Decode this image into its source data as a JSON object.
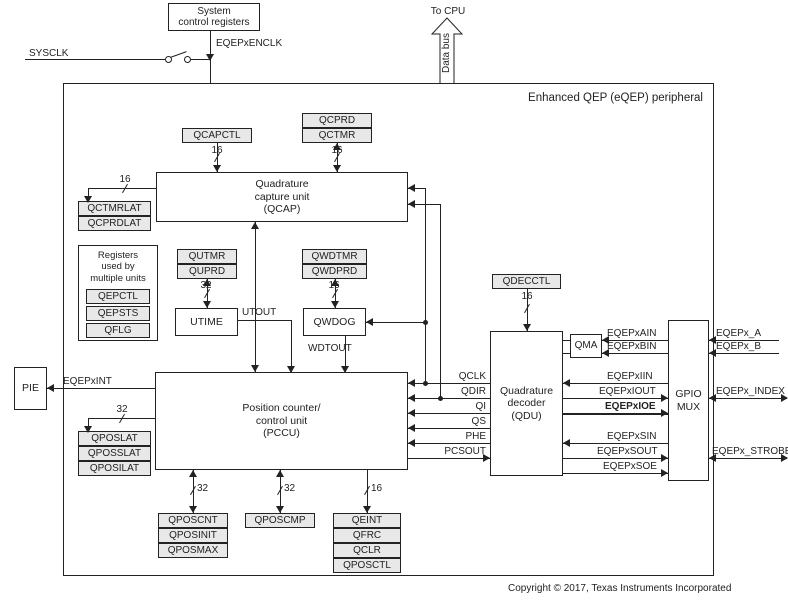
{
  "title": "Enhanced QEP (eQEP) peripheral",
  "top": {
    "sys_ctrl": "System\ncontrol registers",
    "enclk": "EQEPxENCLK",
    "sysclk": "SYSCLK",
    "to_cpu": "To CPU",
    "data_bus": "Data bus"
  },
  "left": {
    "pie": "PIE",
    "eqepxint": "EQEPxINT"
  },
  "qcap": {
    "title": "Quadrature\ncapture unit\n(QCAP)",
    "qcapctl": "QCAPCTL",
    "qcprd": "QCPRD",
    "qctmr": "QCTMR",
    "w_qcapctl": "16",
    "w_qctmr": "16",
    "qctmrlat": "QCTMRLAT",
    "qcprdlat": "QCPRDLAT",
    "w_lat": "16"
  },
  "utime": {
    "title": "UTIME",
    "qutmr": "QUTMR",
    "quprd": "QUPRD",
    "w": "32",
    "utout": "UTOUT"
  },
  "qwdog": {
    "title": "QWDOG",
    "qwdtmr": "QWDTMR",
    "qwdprd": "QWDPRD",
    "w": "16",
    "wdtout": "WDTOUT"
  },
  "shared_regs": {
    "title": "Registers\nused by\nmultiple units",
    "qepctl": "QEPCTL",
    "qepsts": "QEPSTS",
    "qflg": "QFLG"
  },
  "pccu": {
    "title": "Position counter/\ncontrol unit\n(PCCU)",
    "w_lat": "32",
    "qposlat": "QPOSLAT",
    "qposslat": "QPOSSLAT",
    "qposilat": "QPOSILAT",
    "w_cnt": "32",
    "qposcnt": "QPOSCNT",
    "qposinit": "QPOSINIT",
    "qposmax": "QPOSMAX",
    "w_cmp": "32",
    "qposcmp": "QPOSCMP",
    "w_qeint": "16",
    "qeint": "QEINT",
    "qfrc": "QFRC",
    "qclr": "QCLR",
    "qposctl": "QPOSCTL"
  },
  "qdu": {
    "title": "Quadrature\ndecoder\n(QDU)",
    "qdecctl": "QDECCTL",
    "w": "16",
    "qma": "QMA"
  },
  "signals_mid": {
    "qclk": "QCLK",
    "qdir": "QDIR",
    "qi": "QI",
    "qs": "QS",
    "phe": "PHE",
    "pcsout": "PCSOUT"
  },
  "signals_right": {
    "ain": "EQEPxAIN",
    "bin": "EQEPxBIN",
    "iin": "EQEPxIIN",
    "iout": "EQEPxIOUT",
    "ioe": "EQEPxIOE",
    "sin": "EQEPxSIN",
    "sout": "EQEPxSOUT",
    "soe": "EQEPxSOE"
  },
  "gpio": {
    "title": "GPIO\nMUX",
    "a": "EQEPx_A",
    "b": "EQEPx_B",
    "index": "EQEPx_INDEX",
    "strobe": "EQEPx_STROBE"
  },
  "copyright": "Copyright © 2017, Texas Instruments Incorporated"
}
